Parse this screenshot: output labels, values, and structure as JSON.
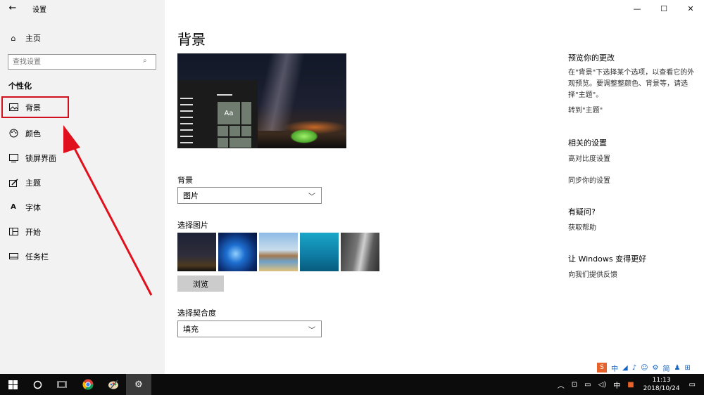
{
  "window": {
    "app_title": "设置",
    "controls": {
      "minimize": "—",
      "maximize": "☐",
      "close": "✕"
    }
  },
  "sidebar": {
    "home_label": "主页",
    "search_placeholder": "查找设置",
    "section_title": "个性化",
    "items": [
      {
        "label": "背景",
        "icon": "picture-icon",
        "active": true
      },
      {
        "label": "颜色",
        "icon": "palette-icon",
        "active": false
      },
      {
        "label": "锁屏界面",
        "icon": "lock-screen-icon",
        "active": false
      },
      {
        "label": "主题",
        "icon": "theme-icon",
        "active": false
      },
      {
        "label": "字体",
        "icon": "font-icon",
        "active": false
      },
      {
        "label": "开始",
        "icon": "start-icon",
        "active": false
      },
      {
        "label": "任务栏",
        "icon": "taskbar-icon",
        "active": false
      }
    ]
  },
  "main": {
    "title": "背景",
    "preview_sample_text": "Aa",
    "background_label": "背景",
    "background_value": "图片",
    "choose_picture_label": "选择图片",
    "browse_label": "浏览",
    "fit_label": "选择契合度",
    "fit_value": "填充"
  },
  "right": {
    "preview_heading": "预览你的更改",
    "preview_text": "在\"背景\"下选择某个选项，以查看它的外观预览。要调整整颜色、背景等，请选择\"主题\"。",
    "goto_theme": "转到\"主题\"",
    "related_heading": "相关的设置",
    "high_contrast": "高对比度设置",
    "sync_settings": "同步你的设置",
    "question_heading": "有疑问?",
    "get_help": "获取帮助",
    "improve_heading": "让 Windows 变得更好",
    "feedback": "向我们提供反馈"
  },
  "ime": {
    "logo": "S",
    "lang": "中",
    "punct": "◢",
    "simp": "简"
  },
  "taskbar": {
    "ime_lang": "中",
    "time": "11:13",
    "date": "2018/10/24"
  },
  "colors": {
    "accent_red": "#d0101c",
    "taskbar_bg": "#0c0c0c",
    "sidebar_bg": "#f2f2f2"
  }
}
